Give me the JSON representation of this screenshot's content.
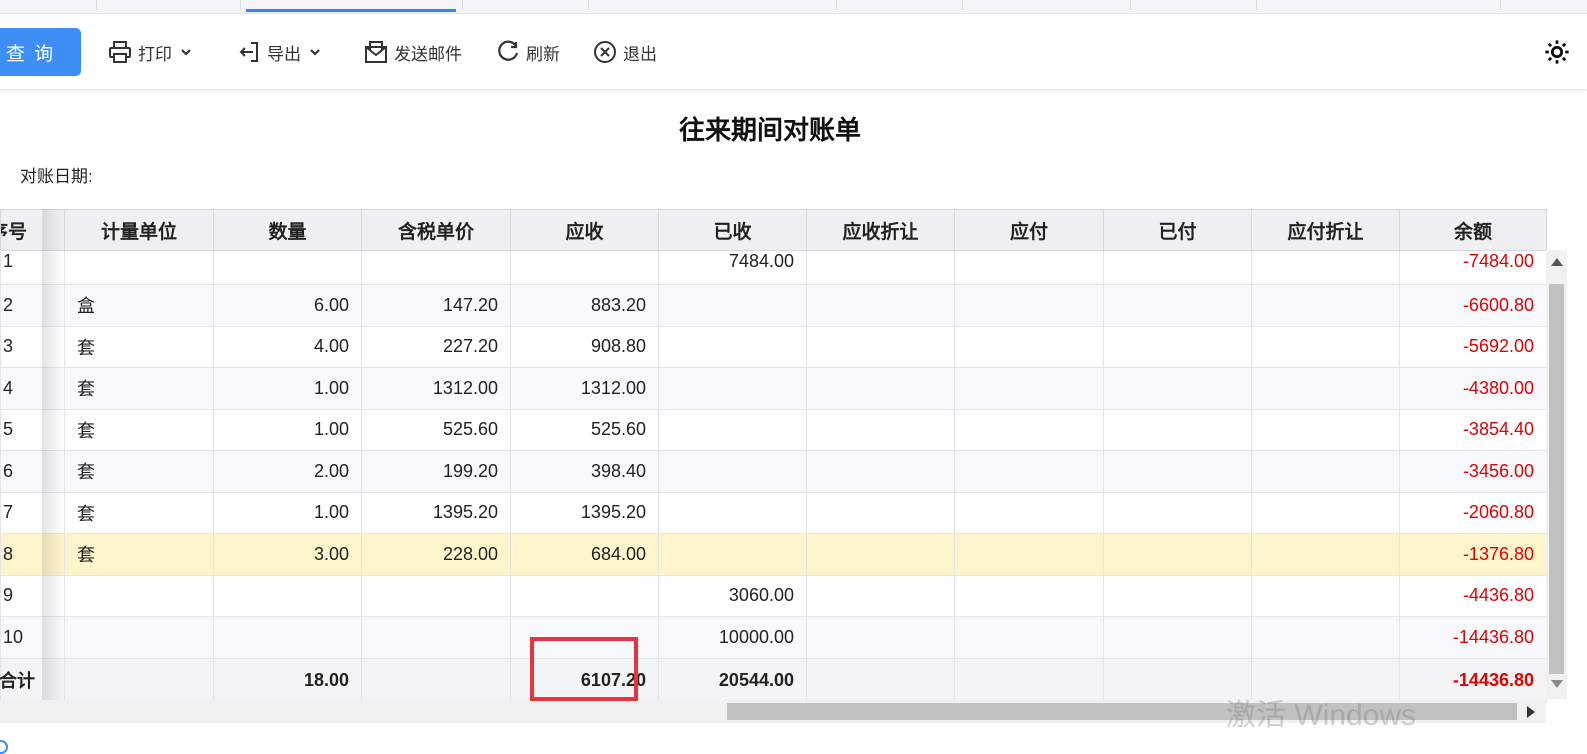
{
  "toolbar": {
    "query_label": "查 询",
    "print_label": "打印",
    "export_label": "导出",
    "email_label": "发送邮件",
    "refresh_label": "刷新",
    "exit_label": "退出"
  },
  "report": {
    "title": "往来期间对账单",
    "date_label": "对账日期:"
  },
  "table": {
    "headers": [
      "序号",
      "计量单位",
      "数量",
      "含税单价",
      "应收",
      "已收",
      "应收折让",
      "应付",
      "已付",
      "应付折让",
      "余额"
    ],
    "rows": [
      {
        "seq": "1",
        "unit": "",
        "qty": "",
        "price": "",
        "receivable": "",
        "received": "7484.00",
        "rec_discount": "",
        "payable": "",
        "paid": "",
        "pay_discount": "",
        "balance": "-7484.00"
      },
      {
        "seq": "2",
        "unit": "盒",
        "qty": "6.00",
        "price": "147.20",
        "receivable": "883.20",
        "received": "",
        "rec_discount": "",
        "payable": "",
        "paid": "",
        "pay_discount": "",
        "balance": "-6600.80"
      },
      {
        "seq": "3",
        "unit": "套",
        "qty": "4.00",
        "price": "227.20",
        "receivable": "908.80",
        "received": "",
        "rec_discount": "",
        "payable": "",
        "paid": "",
        "pay_discount": "",
        "balance": "-5692.00"
      },
      {
        "seq": "4",
        "unit": "套",
        "qty": "1.00",
        "price": "1312.00",
        "receivable": "1312.00",
        "received": "",
        "rec_discount": "",
        "payable": "",
        "paid": "",
        "pay_discount": "",
        "balance": "-4380.00"
      },
      {
        "seq": "5",
        "unit": "套",
        "qty": "1.00",
        "price": "525.60",
        "receivable": "525.60",
        "received": "",
        "rec_discount": "",
        "payable": "",
        "paid": "",
        "pay_discount": "",
        "balance": "-3854.40"
      },
      {
        "seq": "6",
        "unit": "套",
        "qty": "2.00",
        "price": "199.20",
        "receivable": "398.40",
        "received": "",
        "rec_discount": "",
        "payable": "",
        "paid": "",
        "pay_discount": "",
        "balance": "-3456.00"
      },
      {
        "seq": "7",
        "unit": "套",
        "qty": "1.00",
        "price": "1395.20",
        "receivable": "1395.20",
        "received": "",
        "rec_discount": "",
        "payable": "",
        "paid": "",
        "pay_discount": "",
        "balance": "-2060.80"
      },
      {
        "seq": "8",
        "unit": "套",
        "qty": "3.00",
        "price": "228.00",
        "receivable": "684.00",
        "received": "",
        "rec_discount": "",
        "payable": "",
        "paid": "",
        "pay_discount": "",
        "balance": "-1376.80"
      },
      {
        "seq": "9",
        "unit": "",
        "qty": "",
        "price": "",
        "receivable": "",
        "received": "3060.00",
        "rec_discount": "",
        "payable": "",
        "paid": "",
        "pay_discount": "",
        "balance": "-4436.80"
      },
      {
        "seq": "10",
        "unit": "",
        "qty": "",
        "price": "",
        "receivable": "",
        "received": "10000.00",
        "rec_discount": "",
        "payable": "",
        "paid": "",
        "pay_discount": "",
        "balance": "-14436.80"
      }
    ],
    "highlighted_row": 8,
    "total": {
      "label": "合计",
      "qty": "18.00",
      "receivable": "6107.20",
      "received": "20544.00",
      "balance": "-14436.80"
    }
  },
  "watermark": {
    "line1": "激活 Windows"
  },
  "colors": {
    "accent": "#3d8ef5",
    "negative": "#e60000",
    "highlight_row": "#fff5cc",
    "annotation_box": "#e8343a"
  }
}
